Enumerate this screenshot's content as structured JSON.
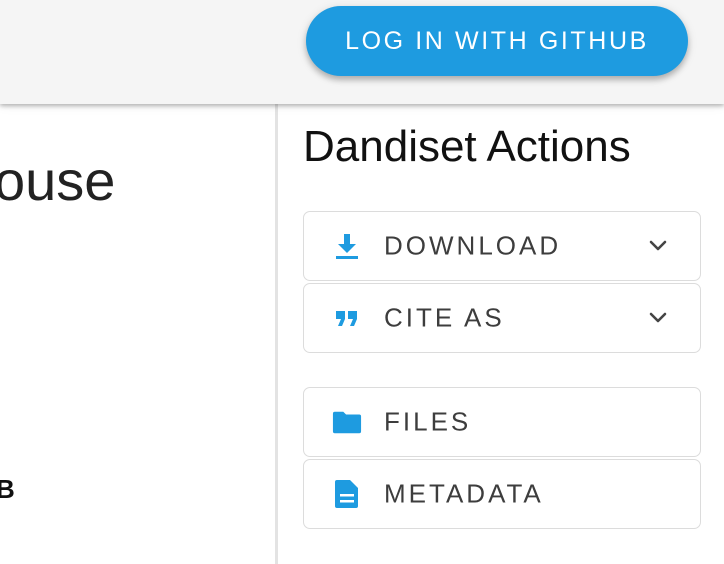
{
  "header": {
    "login_label": "LOG IN WITH GITHUB",
    "accent_color": "#1e9be0"
  },
  "left": {
    "title_fragment": "ouse",
    "size_fragment": "B"
  },
  "actions": {
    "title": "Dandiset Actions",
    "download": {
      "label": "DOWNLOAD",
      "icon": "download-icon"
    },
    "cite": {
      "label": "CITE AS",
      "icon": "quote-icon"
    },
    "files": {
      "label": "FILES",
      "icon": "folder-icon"
    },
    "metadata": {
      "label": "METADATA",
      "icon": "document-icon"
    }
  }
}
